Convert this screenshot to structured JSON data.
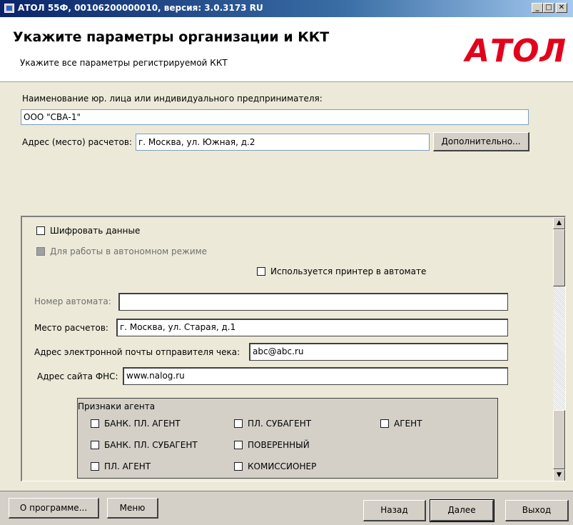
{
  "window": {
    "title": "АТОЛ 55Ф, 00106200000010, версия: 3.0.3173 RU",
    "min_label": "_",
    "max_label": "□",
    "close_label": "✕"
  },
  "header": {
    "title": "Укажите параметры организации и ККТ",
    "subtitle": "Укажите все параметры регистрируемой ККТ",
    "logo": "АТОЛ",
    "logo_color": "#e3001b"
  },
  "org": {
    "name_label": "Наименование юр. лица или индивидуального предпринимателя:",
    "name_value": "ООО \"СВА-1\"",
    "address_label": "Адрес (место) расчетов:",
    "address_value": "г. Москва, ул. Южная, д.2",
    "more_button": "Дополнительно..."
  },
  "panel": {
    "encrypt_label": "Шифровать данные",
    "autonomous_label": "Для работы в автономном режиме",
    "printer_label": "Используется принтер в автомате",
    "machine_number_label": "Номер автомата:",
    "machine_number_value": "",
    "place_label": "Место расчетов:",
    "place_value": "г. Москва, ул. Старая, д.1",
    "email_label": "Адрес электронной почты отправителя чека:",
    "email_value": "abc@abc.ru",
    "fns_label": "Адрес сайта ФНС:",
    "fns_value": "www.nalog.ru",
    "agent_group_title": "Признаки агента",
    "agents": [
      "БАНК. ПЛ. АГЕНТ",
      "ПЛ. СУБАГЕНТ",
      "АГЕНТ",
      "БАНК. ПЛ. СУБАГЕНТ",
      "ПОВЕРЕННЫЙ",
      "ПЛ. АГЕНТ",
      "КОМИССИОНЕР"
    ]
  },
  "footer": {
    "about_button": "О программе...",
    "menu_button": "Меню",
    "back_button": "Назад",
    "next_button": "Далее",
    "exit_button": "Выход"
  }
}
